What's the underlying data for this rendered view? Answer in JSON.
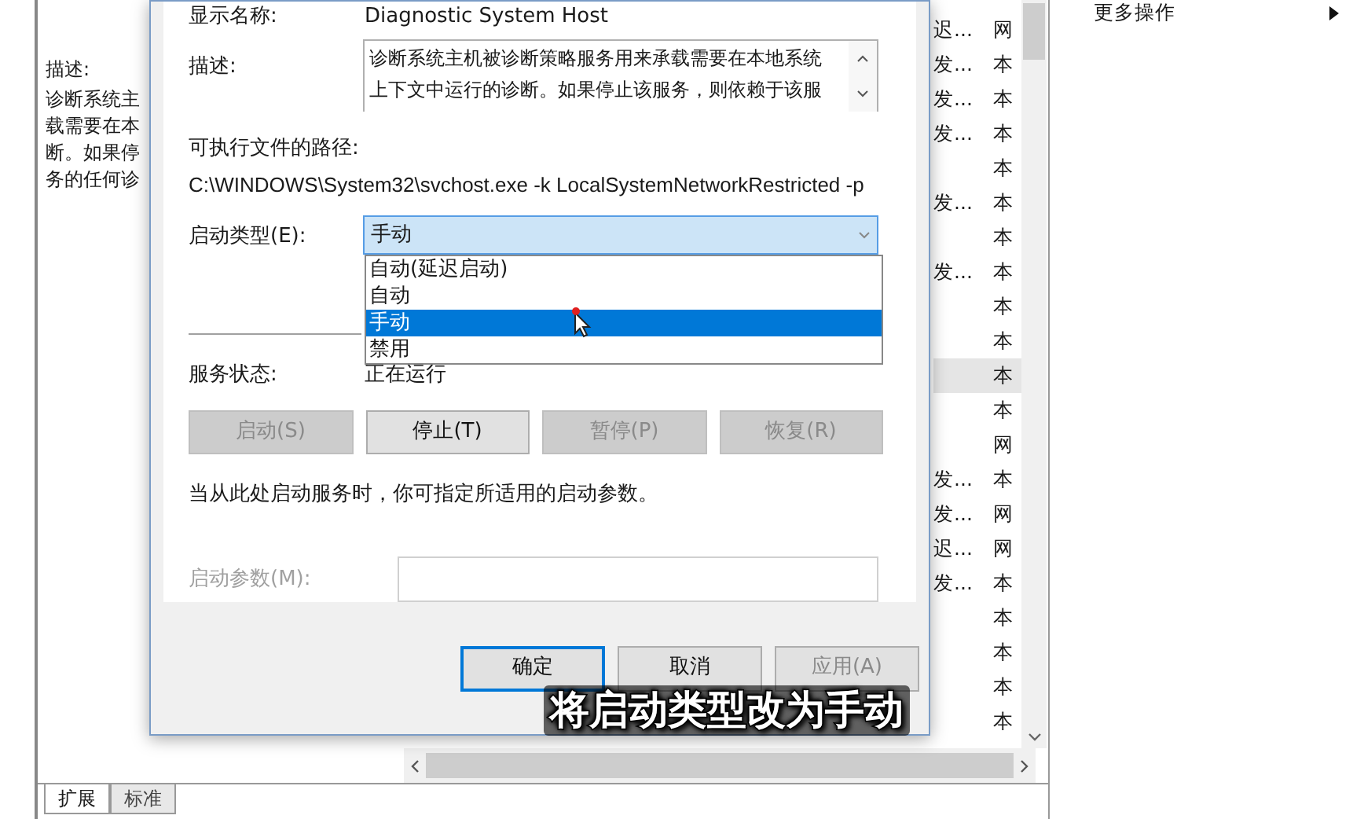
{
  "details_panel": {
    "label": "描述:",
    "lines": [
      "诊断系统主",
      "载需要在本",
      "断。如果停",
      "务的任何诊"
    ]
  },
  "dialog": {
    "display_name": {
      "label": "显示名称:",
      "value": "Diagnostic System Host"
    },
    "description": {
      "label": "描述:",
      "lines": [
        "诊断系统主机被诊断策略服务用来承载需要在本地系统",
        "上下文中运行的诊断。如果停止该服务，则依赖于该服"
      ]
    },
    "path": {
      "label": "可执行文件的路径:",
      "value": "C:\\WINDOWS\\System32\\svchost.exe -k LocalSystemNetworkRestricted -p"
    },
    "startup_type": {
      "label": "启动类型(E):",
      "value": "手动",
      "expanded": true,
      "options": [
        {
          "label": "自动(延迟启动)",
          "selected": false
        },
        {
          "label": "自动",
          "selected": false
        },
        {
          "label": "手动",
          "selected": true
        },
        {
          "label": "禁用",
          "selected": false
        }
      ]
    },
    "service_status": {
      "label": "服务状态:",
      "value": "正在运行"
    },
    "service_buttons": [
      {
        "label": "启动(S)",
        "disabled": true
      },
      {
        "label": "停止(T)",
        "disabled": false
      },
      {
        "label": "暂停(P)",
        "disabled": true
      },
      {
        "label": "恢复(R)",
        "disabled": true
      }
    ],
    "hint": "当从此处启动服务时，你可指定所适用的启动参数。",
    "start_params": {
      "label": "启动参数(M):",
      "disabled": true
    },
    "footer_buttons": [
      {
        "label": "确定",
        "default": true,
        "disabled": false
      },
      {
        "label": "取消",
        "default": false,
        "disabled": false
      },
      {
        "label": "应用(A)",
        "default": false,
        "disabled": true
      }
    ]
  },
  "service_list": {
    "rows": [
      {
        "startup_type": "迟...",
        "log_on_as": "网",
        "selected": false
      },
      {
        "startup_type": "发...",
        "log_on_as": "本",
        "selected": false
      },
      {
        "startup_type": "发...",
        "log_on_as": "本",
        "selected": false
      },
      {
        "startup_type": "发...",
        "log_on_as": "本",
        "selected": false
      },
      {
        "log_on_as": "本",
        "selected": false
      },
      {
        "startup_type": "发...",
        "log_on_as": "本",
        "selected": false
      },
      {
        "log_on_as": "本",
        "selected": false
      },
      {
        "startup_type": "发...",
        "log_on_as": "本",
        "selected": false
      },
      {
        "log_on_as": "本",
        "selected": false
      },
      {
        "log_on_as": "本",
        "selected": false
      },
      {
        "log_on_as": "本",
        "selected": true
      },
      {
        "log_on_as": "本",
        "selected": false
      },
      {
        "log_on_as": "网",
        "selected": false
      },
      {
        "startup_type": "发...",
        "log_on_as": "本",
        "selected": false
      },
      {
        "startup_type": "发...",
        "log_on_as": "网",
        "selected": false
      },
      {
        "startup_type": "迟...",
        "log_on_as": "网",
        "selected": false
      },
      {
        "startup_type": "发...",
        "log_on_as": "本",
        "selected": false
      },
      {
        "log_on_as": "本",
        "selected": false
      },
      {
        "log_on_as": "本",
        "selected": false
      },
      {
        "log_on_as": "本",
        "selected": false
      },
      {
        "log_on_as": "本",
        "selected": false
      }
    ]
  },
  "actions_panel": {
    "items": [
      {
        "label": "更多操作"
      }
    ]
  },
  "view_tabs": [
    {
      "label": "扩展",
      "selected": true
    },
    {
      "label": "标准",
      "selected": false
    }
  ],
  "caption": "将启动类型改为手动"
}
